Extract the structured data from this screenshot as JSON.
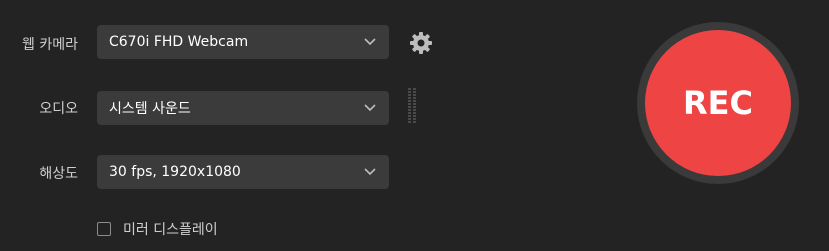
{
  "webcam": {
    "label": "웹 카메라",
    "value": "C670i FHD Webcam"
  },
  "audio": {
    "label": "오디오",
    "value": "시스템 사운드"
  },
  "resolution": {
    "label": "해상도",
    "value": "30 fps, 1920x1080"
  },
  "mirror": {
    "label": "미러 디스플레이",
    "checked": false
  },
  "record_button": {
    "label": "REC",
    "color": "#ef4444"
  },
  "icons": {
    "dropdown": "chevron-down-icon",
    "settings": "gear-icon",
    "audio_level": "audio-level-meter-icon"
  }
}
